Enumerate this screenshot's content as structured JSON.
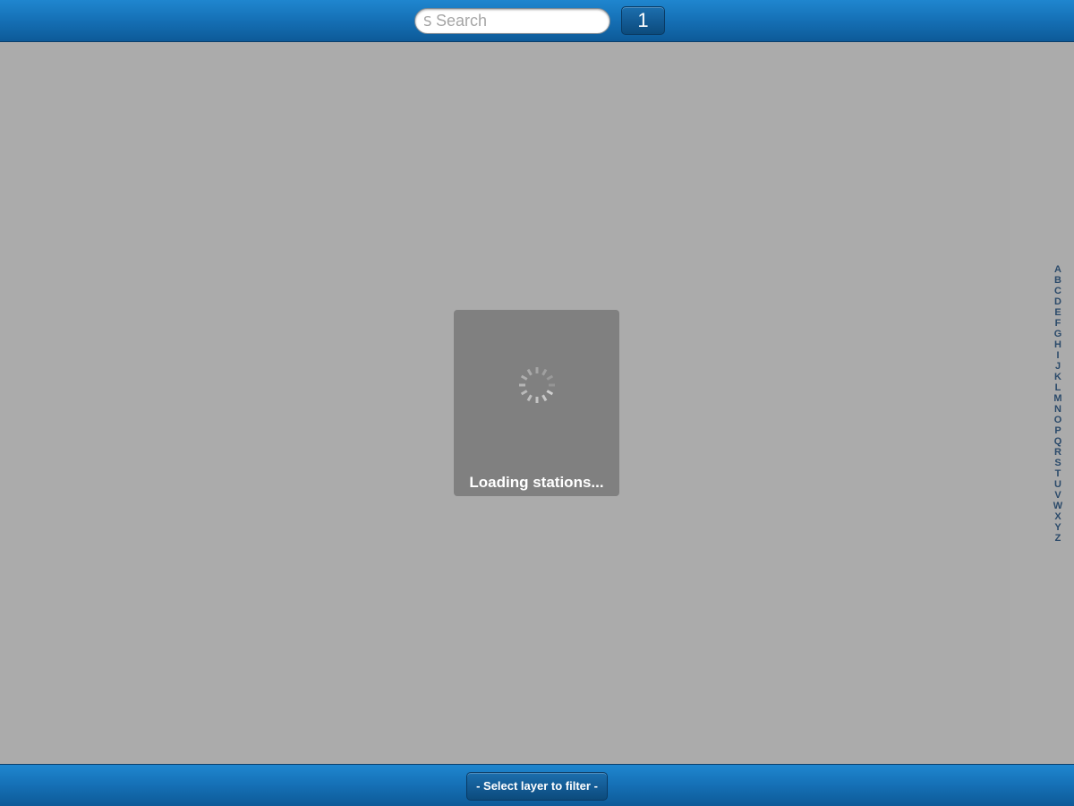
{
  "topbar": {
    "search": {
      "icon": "search-icon",
      "icon_glyph": "S",
      "placeholder": "Search",
      "value": ""
    },
    "count_button_label": "1"
  },
  "alphabet_index": [
    "A",
    "B",
    "C",
    "D",
    "E",
    "F",
    "G",
    "H",
    "I",
    "J",
    "K",
    "L",
    "M",
    "N",
    "O",
    "P",
    "Q",
    "R",
    "S",
    "T",
    "U",
    "V",
    "W",
    "X",
    "Y",
    "Z"
  ],
  "loading": {
    "icon": "spinner-icon",
    "text": "Loading stations..."
  },
  "bottombar": {
    "filter_button_label": "- Select layer to filter -"
  },
  "colors": {
    "bar_blue": "#1672b8",
    "background_gray": "#ababab",
    "overlay_gray": "#808080",
    "index_text": "#2b4a6a"
  }
}
